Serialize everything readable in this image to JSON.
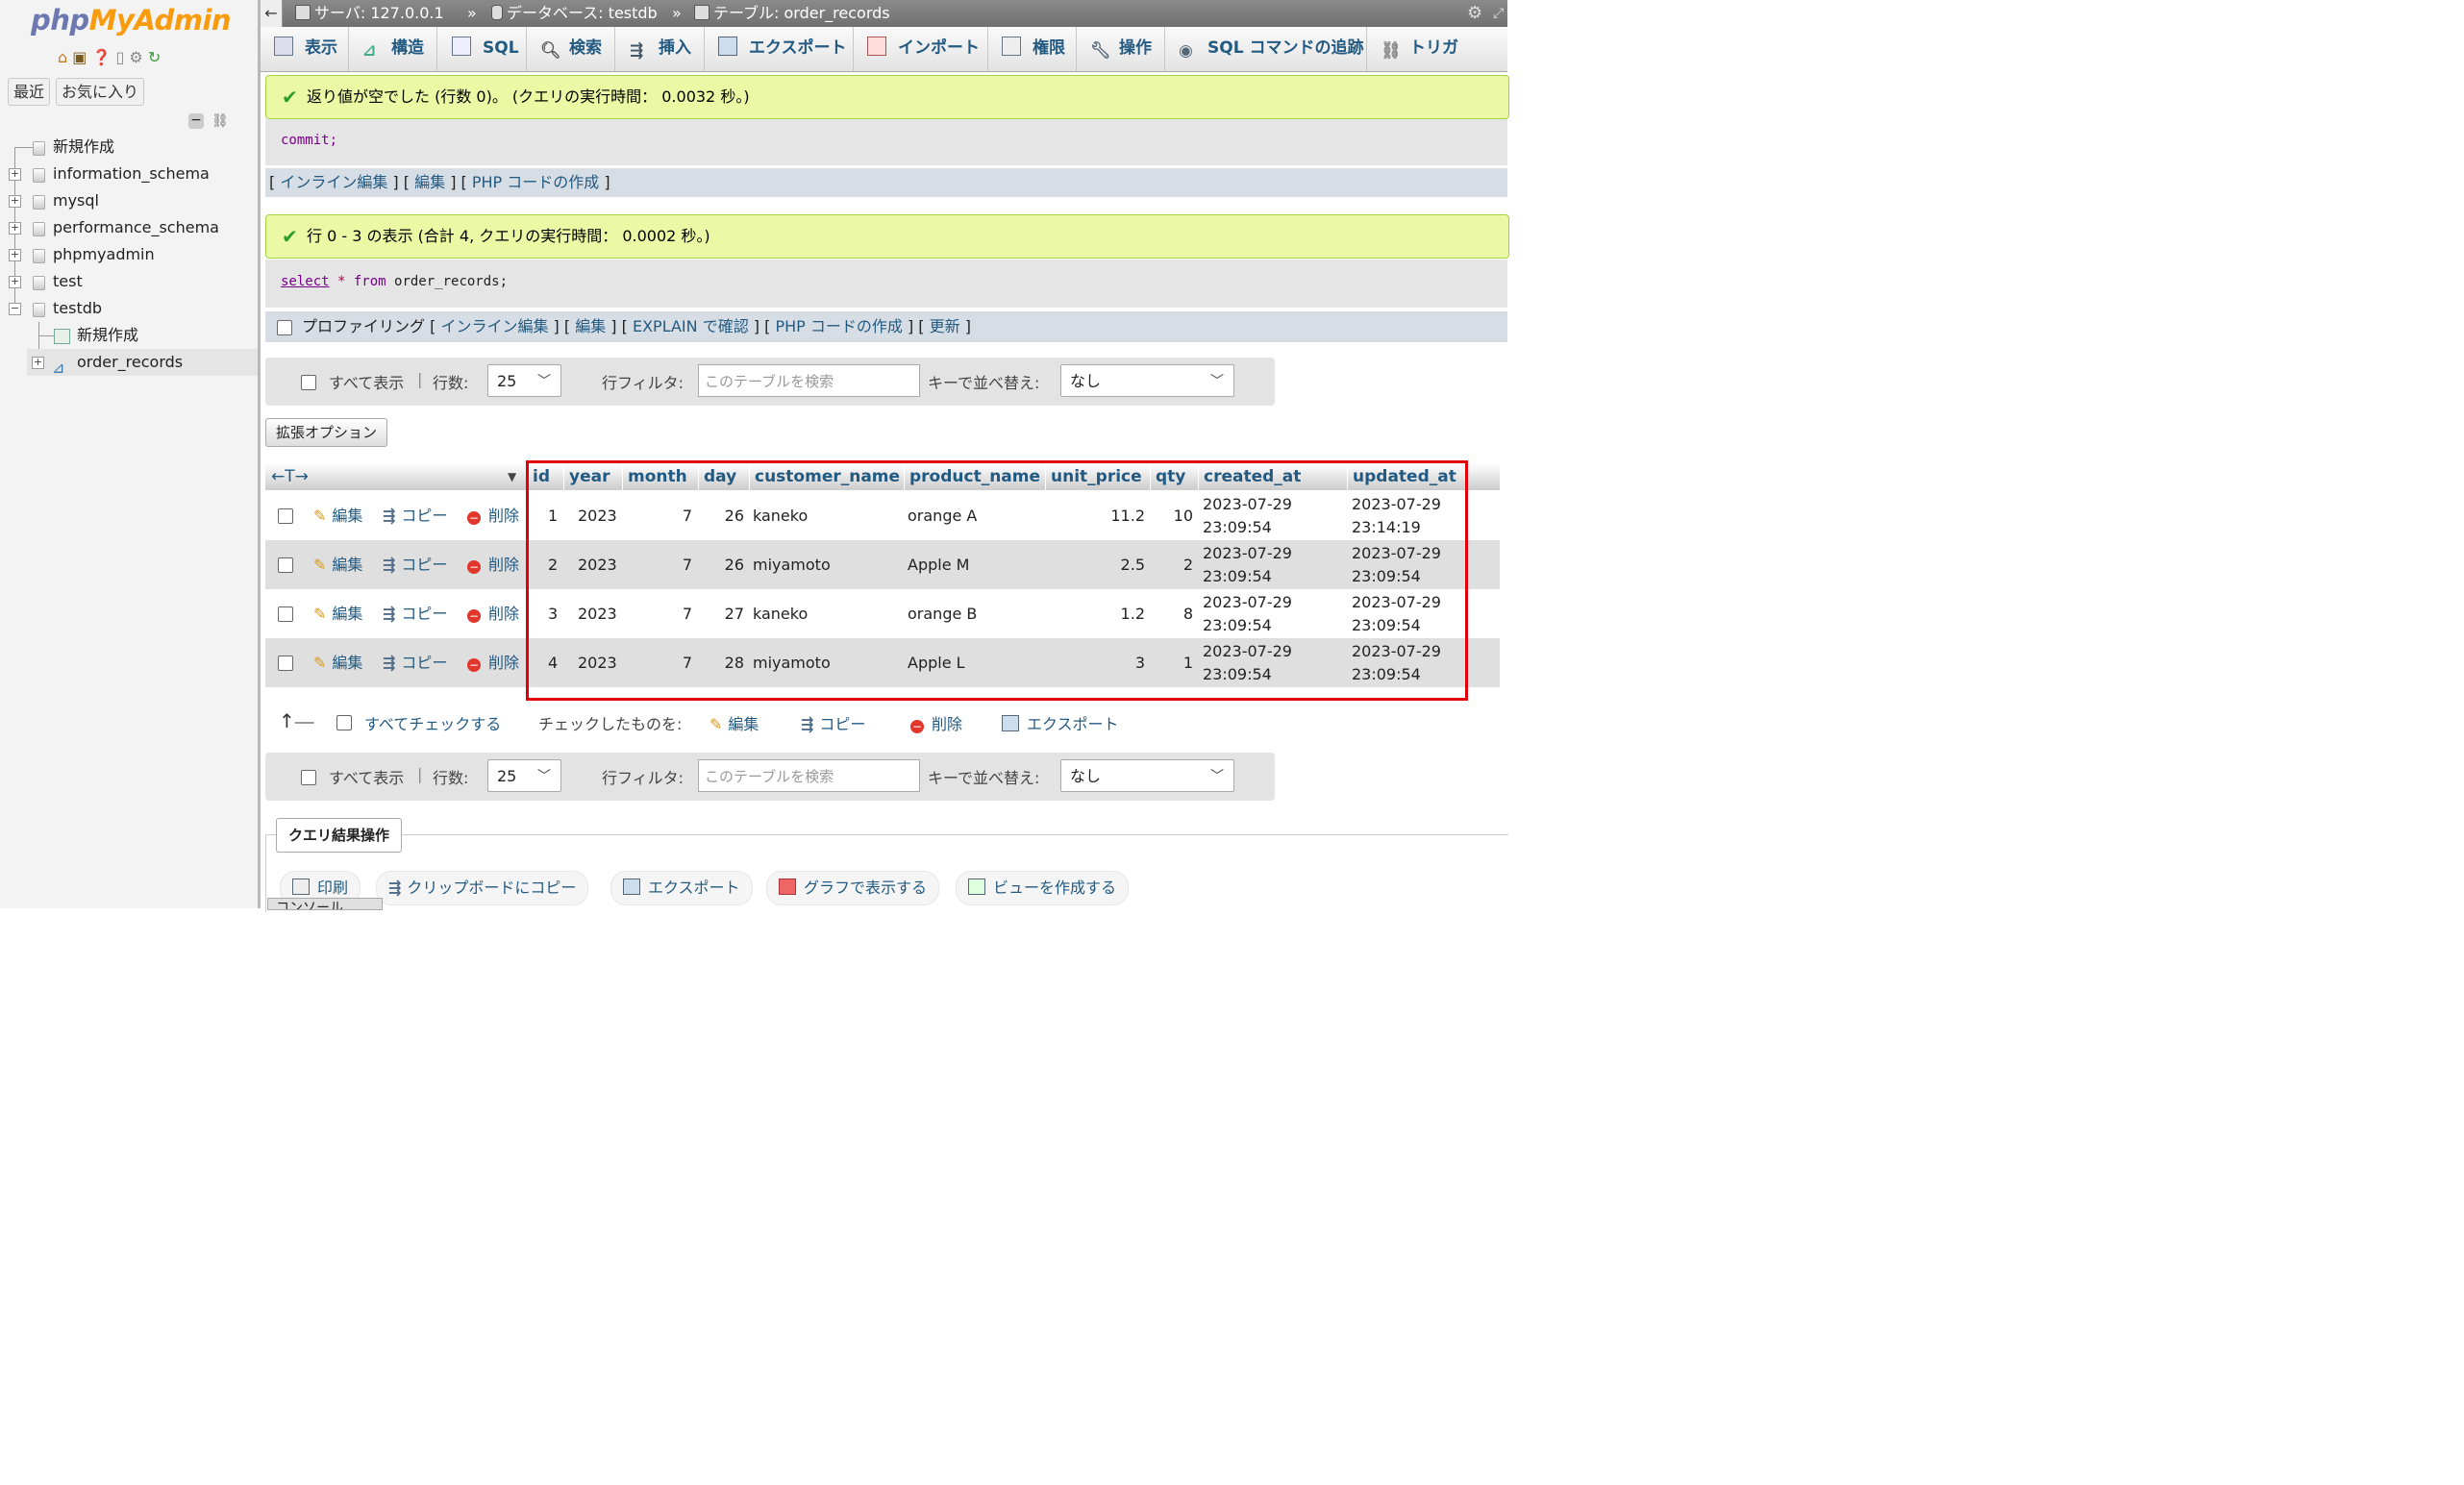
{
  "logo": {
    "part1": "php",
    "part2": "MyAdmin"
  },
  "left_tabs": {
    "recent": "最近",
    "favorites": "お気に入り"
  },
  "tree": {
    "new": "新規作成",
    "databases": [
      "information_schema",
      "mysql",
      "performance_schema",
      "phpmyadmin",
      "test",
      "testdb"
    ],
    "testdb_children": {
      "new": "新規作成",
      "table": "order_records"
    }
  },
  "breadcrumb": {
    "server": "サーバ: 127.0.0.1",
    "sep": "»",
    "database": "データベース: testdb",
    "table": "テーブル: order_records"
  },
  "tabs": [
    "表示",
    "構造",
    "SQL",
    "検索",
    "挿入",
    "エクスポート",
    "インポート",
    "権限",
    "操作",
    "SQL コマンドの追跡",
    "トリガ"
  ],
  "msg1": {
    "text": "返り値が空でした (行数 0)。 (クエリの実行時間： 0.0032 秒。)",
    "sql": "commit;",
    "links": {
      "inline": "インライン編集",
      "edit": "編集",
      "php": "PHP コードの作成"
    }
  },
  "msg2": {
    "text": "行 0 - 3 の表示 (合計 4, クエリの実行時間： 0.0002 秒。)",
    "sql_kw1": "select",
    "sql_star": " * ",
    "sql_kw2": "from",
    "sql_rest": " order_records;",
    "profiling": "プロファイリング",
    "links": {
      "inline": "インライン編集",
      "edit": "編集",
      "explain": "EXPLAIN で確認",
      "php": "PHP コードの作成",
      "refresh": "更新"
    }
  },
  "nav": {
    "show_all": "すべて表示",
    "rows_label": "行数:",
    "rows_value": "25",
    "filter_label": "行フィルタ:",
    "filter_placeholder": "このテーブルを検索",
    "sort_label": "キーで並べ替え:",
    "sort_value": "なし"
  },
  "extended_options": "拡張オプション",
  "table": {
    "arrows": "←T→",
    "columns": [
      "id",
      "year",
      "month",
      "day",
      "customer_name",
      "product_name",
      "unit_price",
      "qty",
      "created_at",
      "updated_at"
    ],
    "actions": {
      "edit": "編集",
      "copy": "コピー",
      "delete": "削除"
    },
    "rows": [
      {
        "id": "1",
        "year": "2023",
        "month": "7",
        "day": "26",
        "customer_name": "kaneko",
        "product_name": "orange A",
        "unit_price": "11.2",
        "qty": "10",
        "created_date": "2023-07-29",
        "created_time": "23:09:54",
        "updated_date": "2023-07-29",
        "updated_time": "23:14:19"
      },
      {
        "id": "2",
        "year": "2023",
        "month": "7",
        "day": "26",
        "customer_name": "miyamoto",
        "product_name": "Apple M",
        "unit_price": "2.5",
        "qty": "2",
        "created_date": "2023-07-29",
        "created_time": "23:09:54",
        "updated_date": "2023-07-29",
        "updated_time": "23:09:54"
      },
      {
        "id": "3",
        "year": "2023",
        "month": "7",
        "day": "27",
        "customer_name": "kaneko",
        "product_name": "orange B",
        "unit_price": "1.2",
        "qty": "8",
        "created_date": "2023-07-29",
        "created_time": "23:09:54",
        "updated_date": "2023-07-29",
        "updated_time": "23:09:54"
      },
      {
        "id": "4",
        "year": "2023",
        "month": "7",
        "day": "28",
        "customer_name": "miyamoto",
        "product_name": "Apple L",
        "unit_price": "3",
        "qty": "1",
        "created_date": "2023-07-29",
        "created_time": "23:09:54",
        "updated_date": "2023-07-29",
        "updated_time": "23:09:54"
      }
    ]
  },
  "bulk": {
    "check_all": "すべてチェックする",
    "checked_label": "チェックしたものを:",
    "edit": "編集",
    "copy": "コピー",
    "delete": "削除",
    "export": "エクスポート"
  },
  "query_ops": {
    "title": "クエリ結果操作",
    "print": "印刷",
    "clipboard": "クリップボードにコピー",
    "export": "エクスポート",
    "chart": "グラフで表示する",
    "view": "ビューを作成する"
  },
  "console": "コンソール",
  "colors": {
    "highlight_box": "#e0000c",
    "link": "#235a81",
    "success_bg": "#ebf8a4"
  }
}
